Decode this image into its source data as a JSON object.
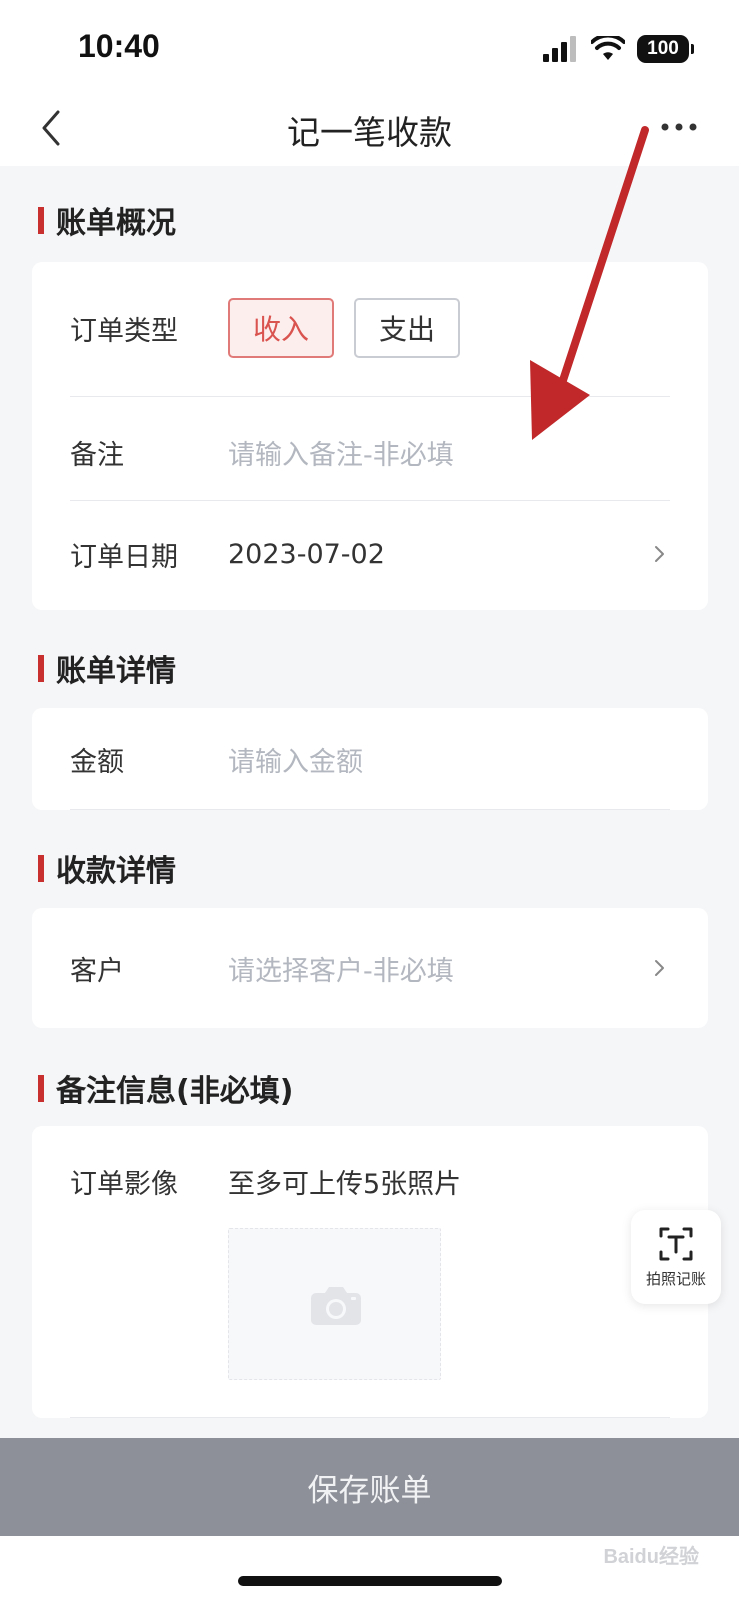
{
  "status_bar": {
    "time": "10:40",
    "battery": "100"
  },
  "nav": {
    "title": "记一笔收款"
  },
  "sections": {
    "overview": {
      "title": "账单概况",
      "order_type_label": "订单类型",
      "income_label": "收入",
      "expense_label": "支出",
      "income_selected": true,
      "remark_label": "备注",
      "remark_placeholder": "请输入备注-非必填",
      "date_label": "订单日期",
      "date_value": "2023-07-02"
    },
    "details": {
      "title": "账单详情",
      "amount_label": "金额",
      "amount_placeholder": "请输入金额"
    },
    "payment": {
      "title": "收款详情",
      "customer_label": "客户",
      "customer_placeholder": "请选择客户-非必填"
    },
    "notes": {
      "title": "备注信息(非必填)",
      "image_label": "订单影像",
      "image_hint": "至多可上传5张照片"
    }
  },
  "float_button": {
    "label": "拍照记账",
    "icon": "scan-text-icon"
  },
  "save_button": {
    "label": "保存账单"
  },
  "watermark": {
    "text": "Baidu经验"
  },
  "colors": {
    "accent": "#c7302f",
    "active_text": "#d9534f",
    "placeholder": "#b3b7bf",
    "save_bar": "#8e9099",
    "annotation_arrow": "#c0282a"
  }
}
